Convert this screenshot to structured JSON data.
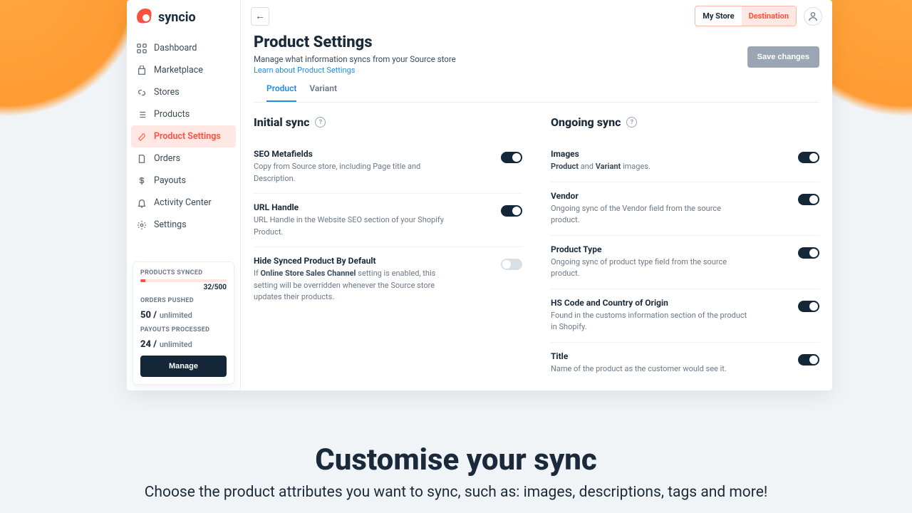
{
  "brand": {
    "name": "syncio"
  },
  "sidebar": {
    "items": [
      {
        "label": "Dashboard"
      },
      {
        "label": "Marketplace"
      },
      {
        "label": "Stores"
      },
      {
        "label": "Products"
      },
      {
        "label": "Product Settings"
      },
      {
        "label": "Orders"
      },
      {
        "label": "Payouts"
      },
      {
        "label": "Activity Center"
      },
      {
        "label": "Settings"
      }
    ]
  },
  "stats": {
    "synced_label": "PRODUCTS SYNCED",
    "synced_value": "32/500",
    "orders_label": "ORDERS PUSHED",
    "orders_value": "50 /",
    "orders_unit": "unlimited",
    "payouts_label": "PAYOUTS PROCESSED",
    "payouts_value": "24 /",
    "payouts_unit": "unlimited",
    "manage": "Manage"
  },
  "topbar": {
    "my_store": "My Store",
    "destination": "Destination"
  },
  "page": {
    "title": "Product Settings",
    "subtitle": "Manage what information syncs from your Source store",
    "learn": "Learn about Product Settings",
    "save": "Save changes"
  },
  "tabs": {
    "product": "Product",
    "variant": "Variant"
  },
  "initial": {
    "heading": "Initial sync",
    "rows": [
      {
        "title": "SEO Metafields",
        "desc": "Copy from Source store, including Page title and Description.",
        "on": true
      },
      {
        "title": "URL Handle",
        "desc": "URL Handle in the Website SEO section of your Shopify Product.",
        "on": true
      },
      {
        "title": "Hide Synced Product By Default",
        "desc_pre": "If ",
        "desc_bold": "Online Store Sales Channel",
        "desc_post": " setting is enabled, this setting will be overridden whenever the Source store updates their products.",
        "on": false
      }
    ]
  },
  "ongoing": {
    "heading": "Ongoing sync",
    "rows": [
      {
        "title": "Images",
        "desc_pre": "",
        "desc_bold": "Product",
        "desc_mid": " and ",
        "desc_bold2": "Variant",
        "desc_post": " images.",
        "on": true
      },
      {
        "title": "Vendor",
        "desc": "Ongoing sync of the Vendor field from the source product.",
        "on": true
      },
      {
        "title": "Product Type",
        "desc": "Ongoing sync of product type field from the source product.",
        "on": true
      },
      {
        "title": "HS Code and Country of Origin",
        "desc": "Found in the customs information section of the product in Shopify.",
        "on": true
      },
      {
        "title": "Title",
        "desc": "Name of the product as the customer would see it.",
        "on": true
      }
    ]
  },
  "hero": {
    "title": "Customise your sync",
    "sub": "Choose the product attributes you want to sync, such as: images, descriptions, tags and more!"
  }
}
